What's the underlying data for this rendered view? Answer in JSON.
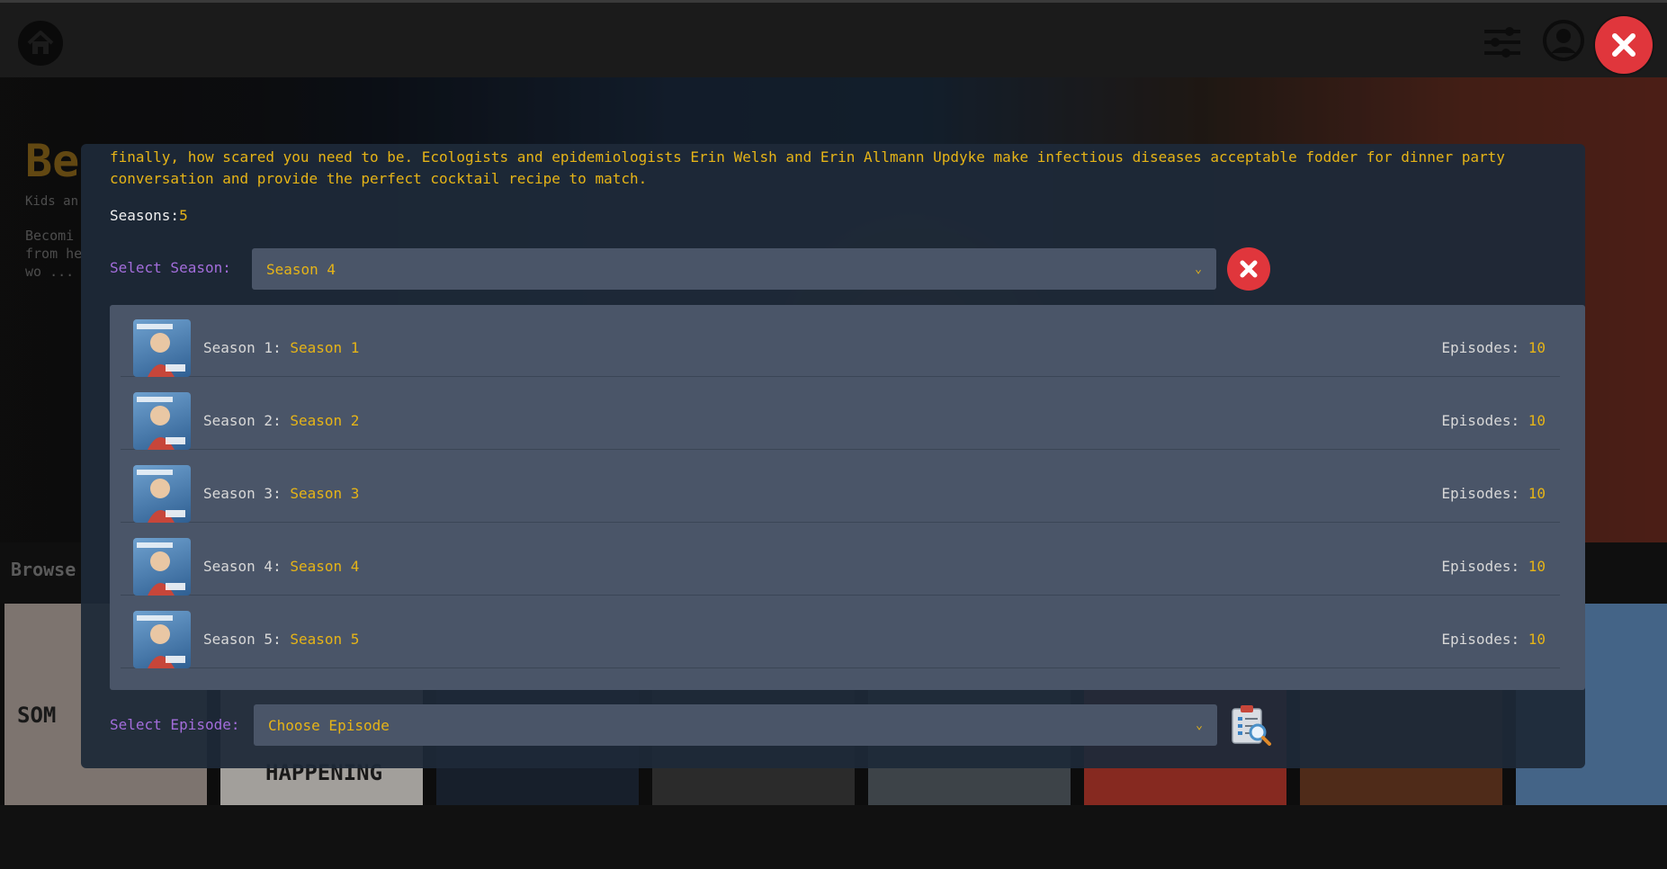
{
  "background": {
    "hero_title": "Be",
    "hero_subtitle": "Kids an",
    "hero_description": "Becomi from he wo ...",
    "browse_label": "Browse",
    "row_thumb_texts": [
      "SOM",
      "HAPPENING"
    ]
  },
  "modal": {
    "description": "finally, how scared you need to be. Ecologists and epidemiologists Erin Welsh and Erin Allmann Updyke make infectious diseases acceptable fodder for dinner party\nconversation and provide the perfect cocktail recipe to match.",
    "seasons_label": "Seasons:",
    "seasons_count": "5",
    "select_season_label": "Select Season:",
    "selected_season": "Season 4",
    "select_episode_label": "Select Episode:",
    "episode_placeholder": "Choose Episode",
    "episodes_label": "Episodes:",
    "seasons": [
      {
        "label": "Season 1:",
        "title": "Season 1",
        "episodes": "10"
      },
      {
        "label": "Season 2:",
        "title": "Season 2",
        "episodes": "10"
      },
      {
        "label": "Season 3:",
        "title": "Season 3",
        "episodes": "10"
      },
      {
        "label": "Season 4:",
        "title": "Season 4",
        "episodes": "10"
      },
      {
        "label": "Season 5:",
        "title": "Season 5",
        "episodes": "10"
      }
    ]
  },
  "icons": {
    "home": "home-icon",
    "filter": "sliders-icon",
    "user": "user-icon",
    "close": "close-icon",
    "clear": "clear-icon",
    "episode_search": "clipboard-search-icon"
  },
  "colors": {
    "accent": "#e6b417",
    "label": "#a36ddb",
    "danger": "#e0363c",
    "panel": "#4a5568"
  }
}
